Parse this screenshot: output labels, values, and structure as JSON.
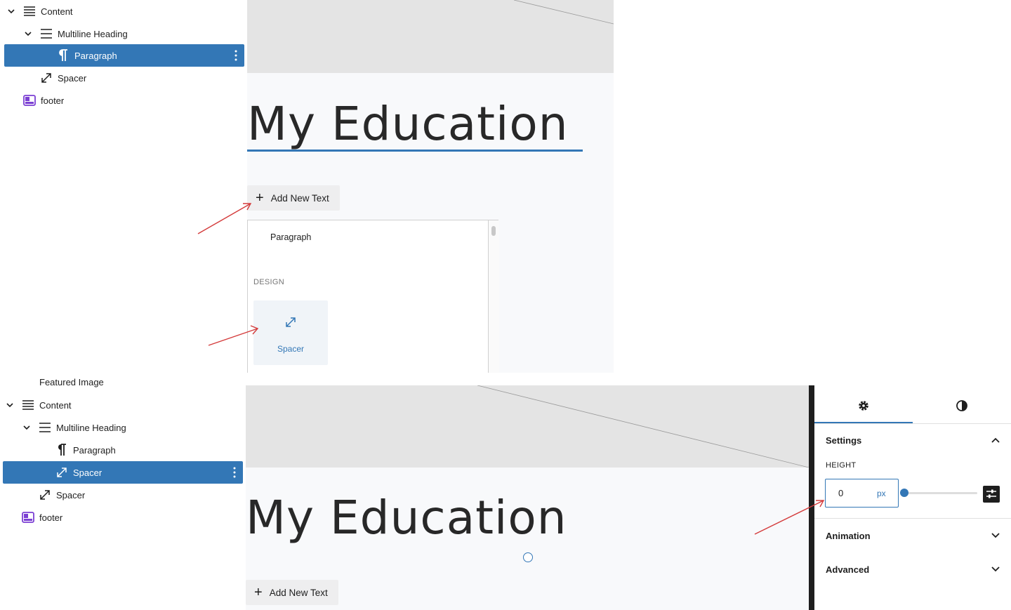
{
  "top": {
    "tree": {
      "content": "Content",
      "multiline_heading": "Multiline Heading",
      "paragraph": "Paragraph",
      "spacer": "Spacer",
      "footer": "footer"
    },
    "canvas": {
      "heading": "My Education",
      "add_button": "Add New Text"
    },
    "inserter": {
      "paragraph_item": "Paragraph",
      "design_label": "DESIGN",
      "spacer_item": "Spacer"
    }
  },
  "bottom": {
    "tree": {
      "partial_item": "Featured Image",
      "content": "Content",
      "multiline_heading": "Multiline Heading",
      "paragraph": "Paragraph",
      "spacer_selected": "Spacer",
      "spacer": "Spacer",
      "footer": "footer"
    },
    "canvas": {
      "heading": "My Education",
      "add_button": "Add New Text"
    },
    "inspector": {
      "settings_label": "Settings",
      "height_label": "HEIGHT",
      "height_value": "0",
      "height_unit": "px",
      "slider_level": 0,
      "animation_label": "Animation",
      "advanced_label": "Advanced"
    }
  },
  "colors": {
    "accent": "#3377b6",
    "selection": "#3377b6",
    "annotation_arrow": "#d43b3b",
    "footer_icon": "#7b3fd3"
  }
}
